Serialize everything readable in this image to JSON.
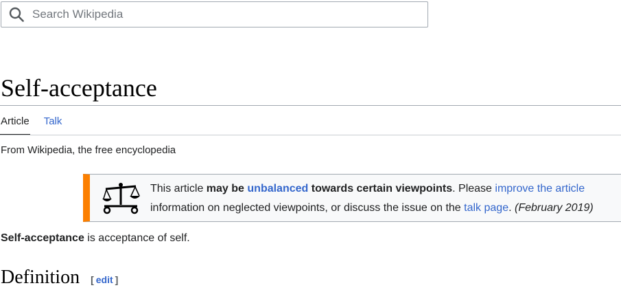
{
  "search": {
    "placeholder": "Search Wikipedia",
    "icon": "search-icon"
  },
  "article": {
    "title": "Self-acceptance",
    "tabs": [
      {
        "label": "Article",
        "active": true
      },
      {
        "label": "Talk",
        "active": false
      }
    ],
    "tagline": "From Wikipedia, the free encyclopedia"
  },
  "notice": {
    "icon": "scales-icon",
    "accent_color": "#fc7f00",
    "line1": {
      "t1": "This article ",
      "b1": "may be ",
      "link1": "unbalanced",
      "b2": " towards certain viewpoints",
      "t2": ". Please ",
      "link2": "improve the article"
    },
    "line2": {
      "t1": "information on neglected viewpoints, or discuss the issue on the ",
      "link1": "talk page",
      "t2": ". ",
      "date": "(February 2019)"
    }
  },
  "lead": {
    "bold": "Self-acceptance",
    "rest": " is acceptance of self."
  },
  "section": {
    "heading": "Definition",
    "edit_open": "[",
    "edit_label": "edit",
    "edit_close": "]"
  },
  "colors": {
    "link": "#3366cc",
    "text": "#202122"
  }
}
